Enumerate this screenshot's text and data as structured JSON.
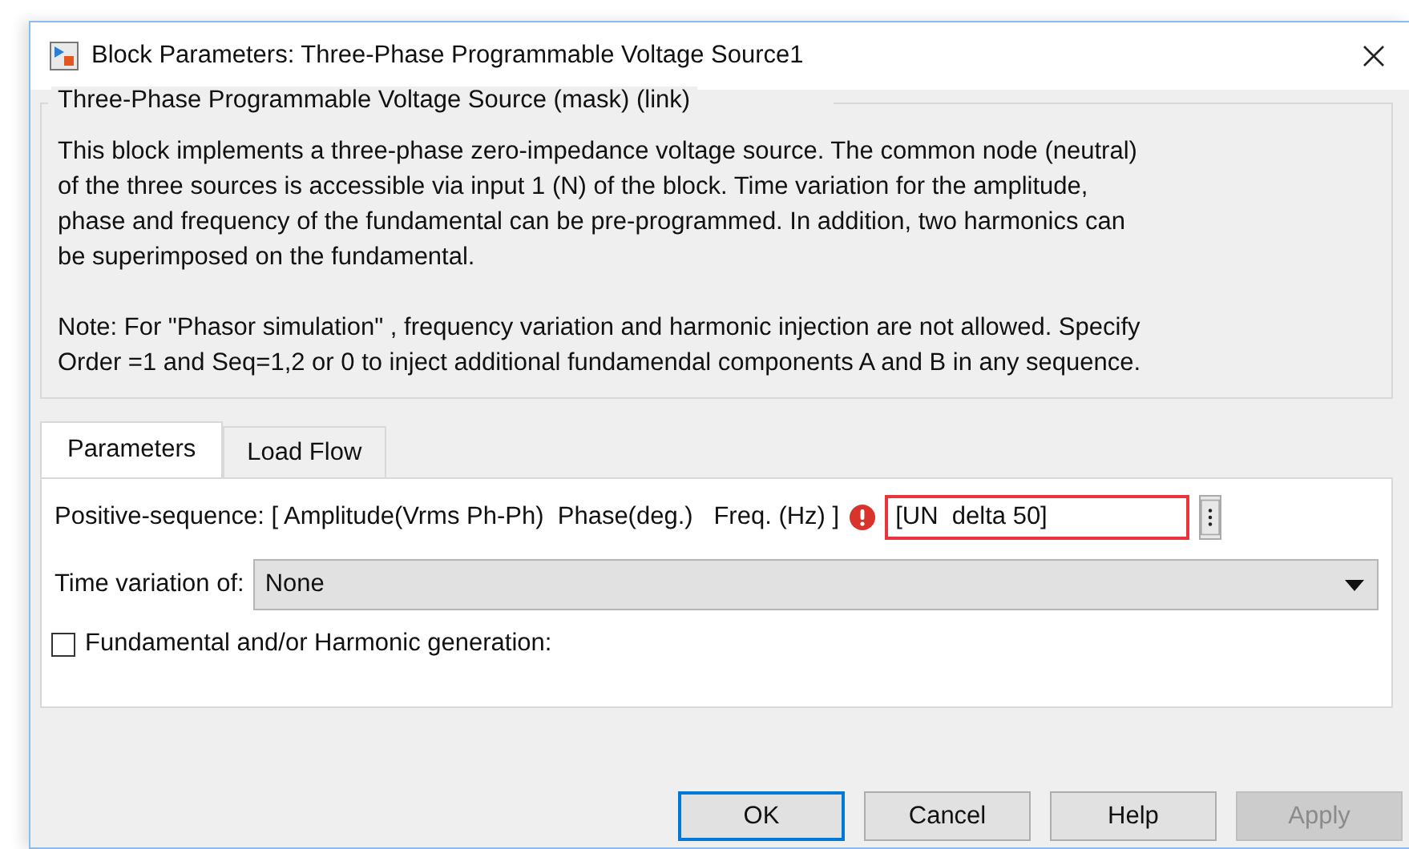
{
  "window": {
    "title": "Block Parameters: Three-Phase Programmable Voltage Source1"
  },
  "group": {
    "title": "Three-Phase Programmable Voltage Source (mask) (link)",
    "description_lines": [
      "This block implements a three-phase zero-impedance voltage source. The common node (neutral)",
      "of the three sources is accessible via input 1 (N) of the block. Time variation for the amplitude,",
      "phase and frequency of the fundamental can be pre-programmed. In addition, two harmonics can",
      "be superimposed on the fundamental."
    ],
    "note_lines": [
      "Note: For  \"Phasor simulation\" , frequency variation and harmonic injection are not allowed.  Specify",
      "Order =1 and Seq=1,2 or 0 to inject additional fundamendal components A and B in  any sequence."
    ]
  },
  "tabs": [
    {
      "label": "Parameters",
      "selected": true
    },
    {
      "label": "Load Flow",
      "selected": false
    }
  ],
  "parameters": [
    {
      "kind": "text",
      "label": "Positive-sequence: [ Amplitude(Vrms Ph-Ph)  Phase(deg.)   Freq. (Hz) ]",
      "value": "[UN  delta 50]",
      "error": true
    },
    {
      "kind": "dropdown",
      "label": "Time variation of:",
      "value": "None"
    },
    {
      "kind": "checkbox",
      "label": "Fundamental and/or Harmonic generation:",
      "checked": false
    }
  ],
  "buttons": [
    {
      "label": "OK",
      "default": true,
      "disabled": false
    },
    {
      "label": "Cancel",
      "default": false,
      "disabled": false
    },
    {
      "label": "Help",
      "default": false,
      "disabled": false
    },
    {
      "label": "Apply",
      "default": false,
      "disabled": true
    }
  ]
}
